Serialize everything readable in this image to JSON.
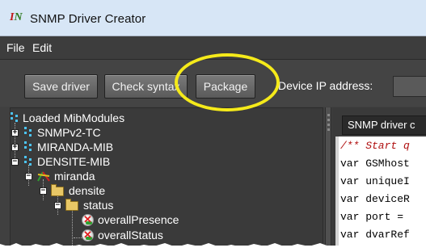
{
  "window": {
    "title": "SNMP Driver Creator"
  },
  "menubar": {
    "items": [
      {
        "label": "File"
      },
      {
        "label": "Edit"
      }
    ]
  },
  "toolbar": {
    "save_label": "Save driver",
    "check_label": "Check syntax",
    "package_label": "Package",
    "ip_label": "Device IP address:",
    "ip_value": ""
  },
  "tree": {
    "root_label": "Loaded MibModules",
    "nodes": [
      {
        "label": "SNMPv2-TC",
        "expander": "+"
      },
      {
        "label": "MIRANDA-MIB",
        "expander": "+"
      },
      {
        "label": "DENSITE-MIB",
        "expander": "−"
      },
      {
        "label": "miranda",
        "expander": "−"
      },
      {
        "label": "densite",
        "expander": "−"
      },
      {
        "label": "status",
        "expander": "−"
      },
      {
        "label": "overallPresence",
        "expander": ""
      },
      {
        "label": "overallStatus",
        "expander": ""
      }
    ]
  },
  "editor": {
    "tab_label": "SNMP driver c",
    "lines": [
      "/** Start q",
      "var GSMhost",
      "var uniqueI",
      "var deviceR",
      "var port = ",
      "var dvarRef"
    ]
  },
  "colors": {
    "highlight": "#f5ea1a",
    "titlebar": "#d7e6f6",
    "panel": "#3a3a3a",
    "comment": "#b01010"
  }
}
